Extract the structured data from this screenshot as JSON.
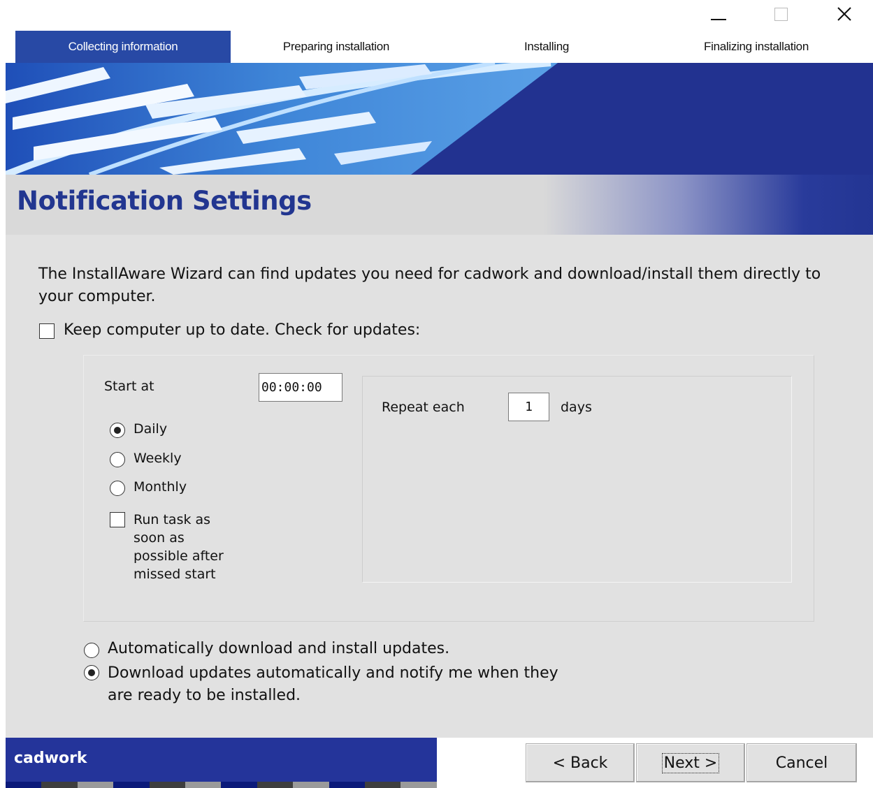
{
  "window": {
    "minimize_icon": "minimize-icon",
    "maximize_icon": "maximize-icon",
    "close_icon": "close-icon",
    "close_glyph": "✕"
  },
  "steps": [
    {
      "label": "Collecting information",
      "active": true
    },
    {
      "label": "Preparing installation",
      "active": false
    },
    {
      "label": "Installing",
      "active": false
    },
    {
      "label": "Finalizing installation",
      "active": false
    }
  ],
  "page": {
    "title": "Notification Settings",
    "description": "The InstallAware Wizard can find updates you need for cadwork and download/install them directly to your computer."
  },
  "keep_up_to_date": {
    "label": "Keep computer up to date. Check for updates:",
    "checked": false
  },
  "schedule": {
    "start_at_label": "Start at",
    "start_at_value": "00:00:00",
    "frequency_options": [
      {
        "label": "Daily",
        "checked": true
      },
      {
        "label": "Weekly",
        "checked": false
      },
      {
        "label": "Monthly",
        "checked": false
      }
    ],
    "run_missed": {
      "lines": [
        "Run task as",
        "soon as",
        "possible after",
        "missed start"
      ],
      "checked": false
    },
    "repeat_label": "Repeat each",
    "repeat_value": "1",
    "repeat_unit": "days"
  },
  "update_mode": {
    "options": [
      {
        "lines": [
          "Automatically download and install updates."
        ],
        "checked": false
      },
      {
        "lines": [
          "Download updates automatically and notify me when they",
          "are ready to be installed."
        ],
        "checked": true
      }
    ]
  },
  "footer": {
    "brand": "cadwork",
    "back_label": "< Back",
    "next_label": "Next >",
    "cancel_label": "Cancel"
  },
  "colors": {
    "accent": "#2849a5",
    "title": "#223690",
    "brand_band": "#24349a",
    "content_bg": "#e1e1e1"
  }
}
